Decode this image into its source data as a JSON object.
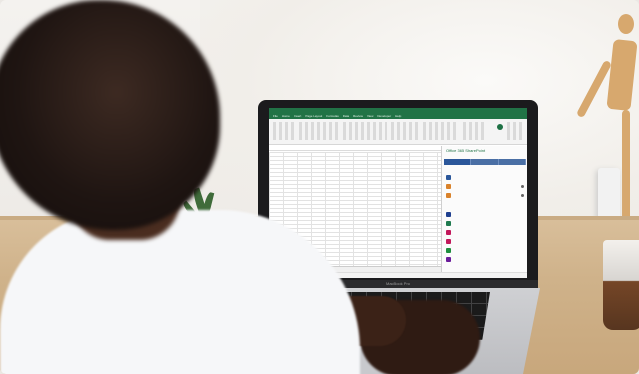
{
  "excel": {
    "menu_tabs": [
      "File",
      "Home",
      "Insert",
      "Page Layout",
      "Formulas",
      "Data",
      "Review",
      "View",
      "Developer",
      "Help"
    ],
    "pane_title": "Office 365 SharePoint",
    "pane_tabs": [
      "",
      "",
      ""
    ],
    "pane_rows_top": [
      "",
      ""
    ],
    "pane_rows": [
      "",
      "",
      "",
      "",
      "",
      ""
    ],
    "sheet_tab": "Sheet1"
  },
  "laptop": {
    "chin_label": "MacBook Pro"
  },
  "colors": {
    "excel_green": "#217346",
    "pane_blue": "#2b579a",
    "desk_wood": "#cfb28a"
  }
}
